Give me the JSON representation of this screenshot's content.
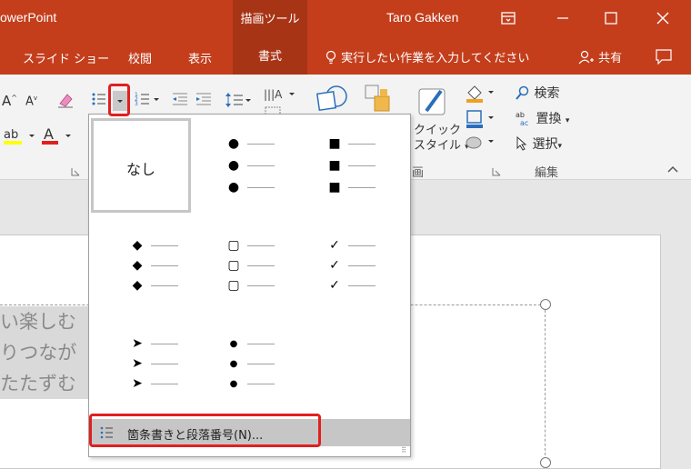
{
  "titlebar": {
    "app_title": "owerPoint",
    "context_group": "描画ツール",
    "user_name": "Taro Gakken"
  },
  "tabs": {
    "slideshow": "スライド ショー",
    "review": "校閲",
    "view": "表示",
    "format": "書式",
    "tell_me": "実行したい作業を入力してください",
    "share": "共有"
  },
  "ribbon": {
    "quick_style": "クイック",
    "quick_style2": "スタイル",
    "find": "検索",
    "replace": "置換",
    "select": "選択",
    "group_editing": "編集",
    "group_drawing": "画"
  },
  "dropdown": {
    "none_label": "なし",
    "footer_label": "箇条書きと段落番号(N)..."
  },
  "slide": {
    "lines": [
      "い楽しむ",
      "りつなが",
      "たたずむ"
    ]
  },
  "colors": {
    "accent": "#c43e1c",
    "accent_dark": "#a83416",
    "highlight": "#e02020"
  }
}
